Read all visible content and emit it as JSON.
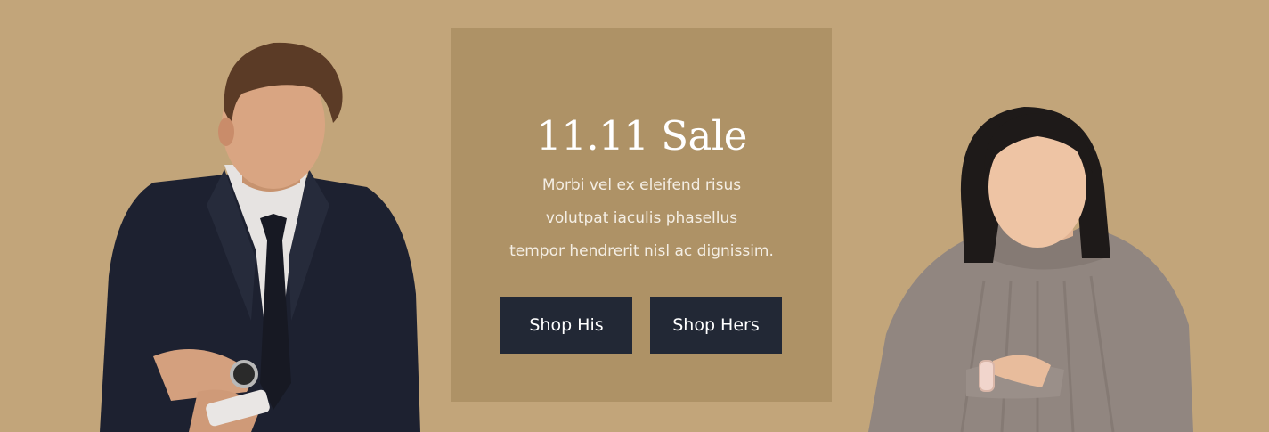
{
  "promo": {
    "title": "11.11 Sale",
    "description_lines": [
      "Morbi vel ex eleifend risus",
      "volutpat iaculis phasellus",
      "tempor hendrerit nisl ac dignissim."
    ],
    "buttons": {
      "his": "Shop His",
      "hers": "Shop Hers"
    }
  },
  "colors": {
    "background": "#c2a57a",
    "card": "#ae9266",
    "button": "#222835",
    "button_text": "#ffffff"
  }
}
